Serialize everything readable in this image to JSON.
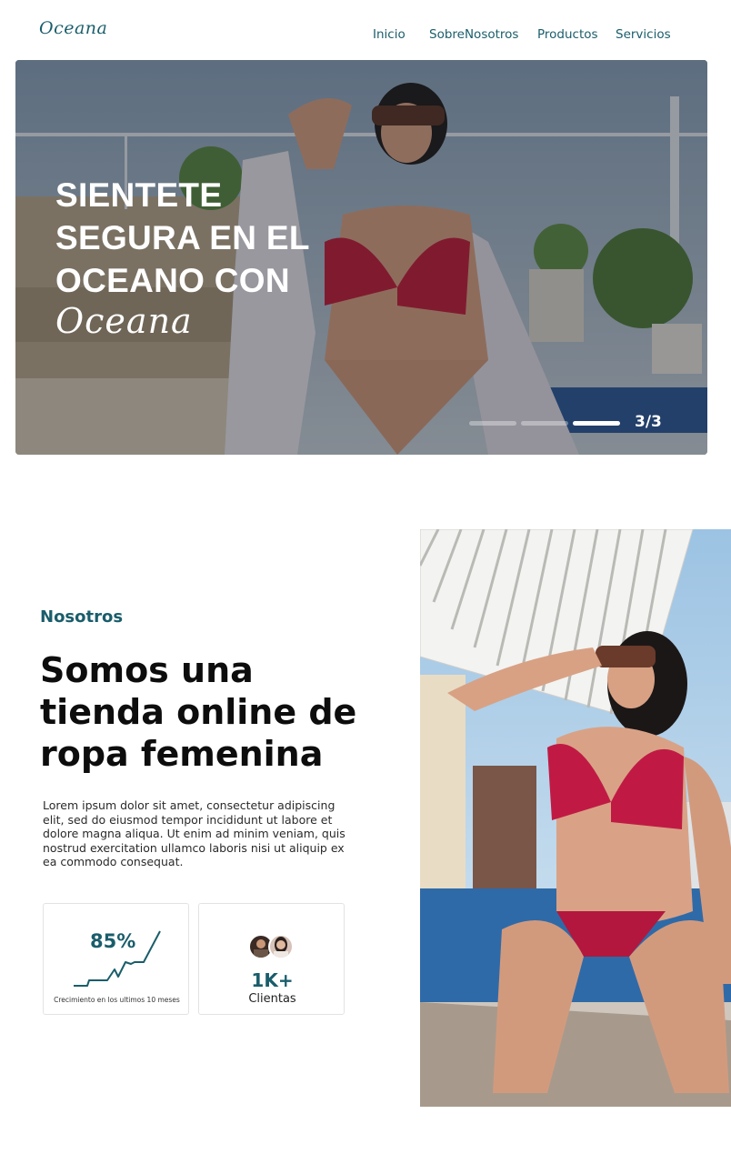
{
  "header": {
    "logo": "Oceana",
    "nav": [
      "Inicio",
      "SobreNosotros",
      "Productos",
      "Servicios"
    ]
  },
  "hero": {
    "title_lines": [
      "SIENTETE",
      "SEGURA EN EL",
      "OCEANO CON"
    ],
    "brand": "Oceana",
    "slide_counter": "3/3",
    "slides_total": 3,
    "active_slide": 3
  },
  "about": {
    "label": "Nosotros",
    "title": "Somos una tienda online de ropa femenina",
    "body": "Lorem ipsum dolor sit amet, consectetur adipiscing elit, sed do eiusmod tempor incididunt ut labore et dolore magna aliqua. Ut enim ad minim veniam, quis nostrud exercitation ullamco laboris nisi ut aliquip ex ea commodo consequat.",
    "stats": {
      "growth": {
        "value": "85%",
        "caption": "Crecimiento en los ultimos 10 meses"
      },
      "clients": {
        "value": "1K+",
        "label": "Clientas"
      }
    }
  },
  "colors": {
    "brand": "#1a5d6b",
    "text": "#0d0d0d",
    "card_border": "#e3e3e3"
  }
}
